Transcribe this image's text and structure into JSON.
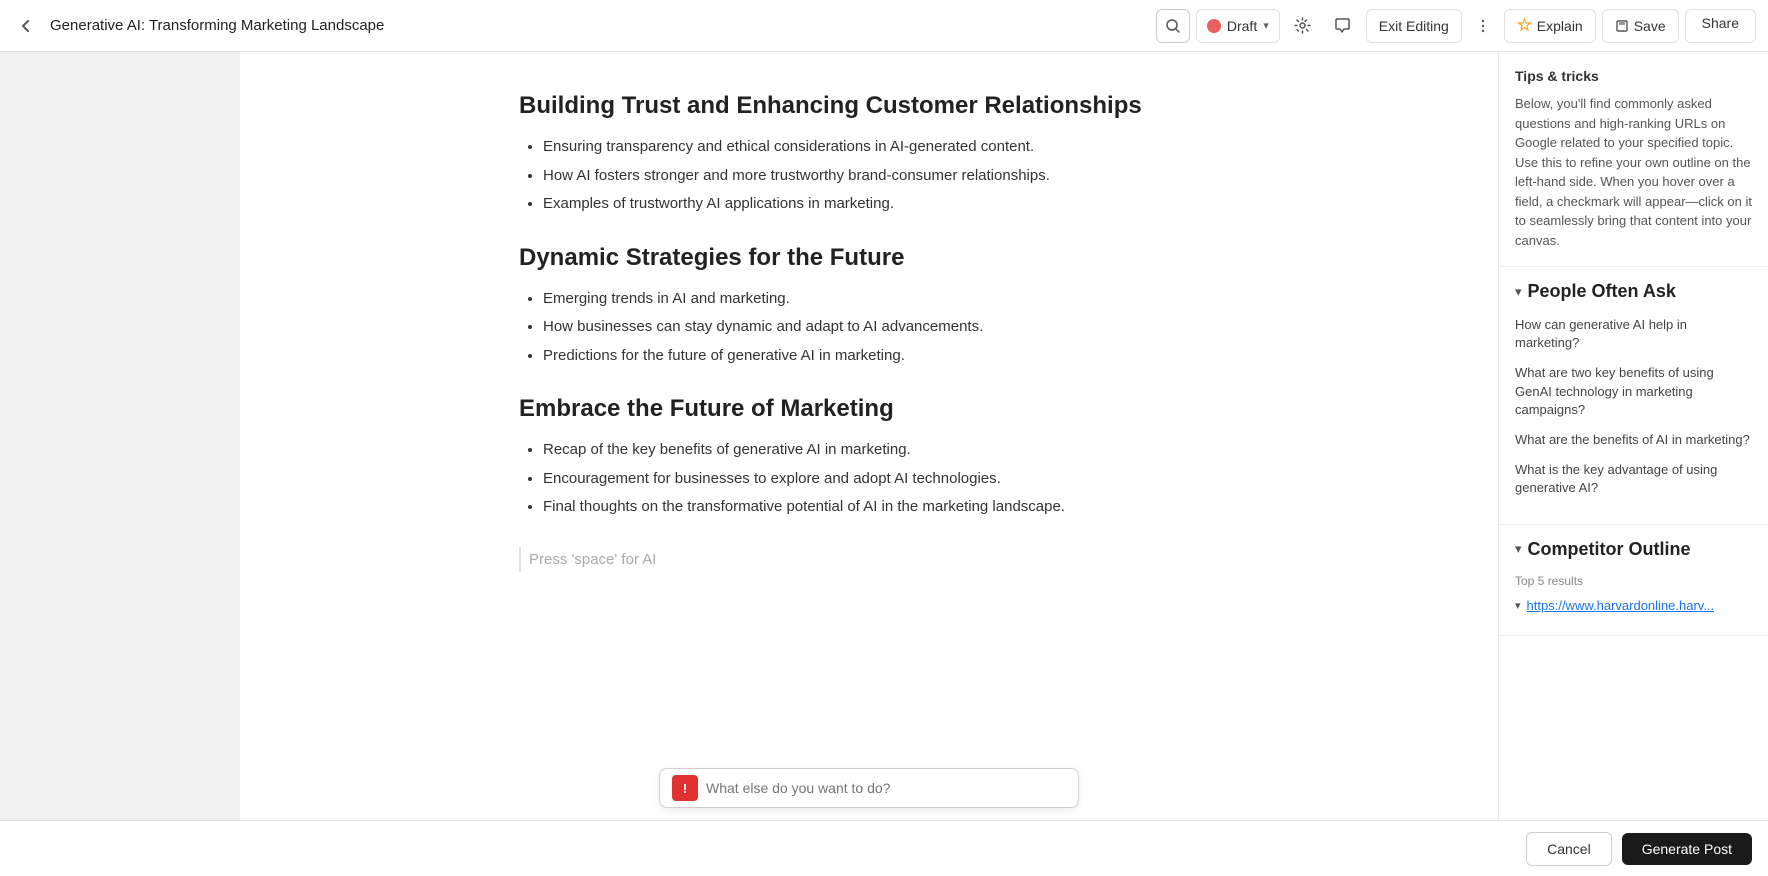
{
  "topbar": {
    "doc_title": "Generative AI: Transforming Marketing Landscape",
    "status_label": "Draft",
    "exit_editing_label": "Exit Editing",
    "explain_label": "Explain",
    "save_label": "Save",
    "share_label": "Share"
  },
  "editor": {
    "section1_heading": "Building Trust and Enhancing Customer Relationships",
    "section1_bullets": [
      "Ensuring transparency and ethical considerations in AI-generated content.",
      "How AI fosters stronger and more trustworthy brand-consumer relationships.",
      "Examples of trustworthy AI applications in marketing."
    ],
    "section2_heading": "Dynamic Strategies for the Future",
    "section2_bullets": [
      "Emerging trends in AI and marketing.",
      "How businesses can stay dynamic and adapt to AI advancements.",
      "Predictions for the future of generative AI in marketing."
    ],
    "section3_heading": "Embrace the Future of Marketing",
    "section3_bullets": [
      "Recap of the key benefits of generative AI in marketing.",
      "Encouragement for businesses to explore and adopt AI technologies.",
      "Final thoughts on the transformative potential of AI in the marketing landscape."
    ],
    "press_space_placeholder": "Press 'space' for AI",
    "ai_input_placeholder": "What else do you want to do?",
    "ai_icon_label": "!"
  },
  "right_panel": {
    "tips_title": "Tips & tricks",
    "tips_text": "Below, you'll find commonly asked questions and high-ranking URLs on Google related to your specified topic. Use this to refine your own outline on the left-hand side. When you hover over a field, a checkmark will appear—click on it to seamlessly bring that content into your canvas.",
    "poa_section_title": "People Often Ask",
    "poa_items": [
      "How can generative AI help in marketing?",
      "What are two key benefits of using GenAI technology in marketing campaigns?",
      "What are the benefits of AI in marketing?",
      "What is the key advantage of using generative AI?"
    ],
    "competitor_section_title": "Competitor Outline",
    "competitor_top_results_label": "Top 5 results",
    "competitor_links": [
      "https://www.harvardonline.harv..."
    ]
  },
  "action_bar": {
    "cancel_label": "Cancel",
    "generate_label": "Generate Post"
  }
}
